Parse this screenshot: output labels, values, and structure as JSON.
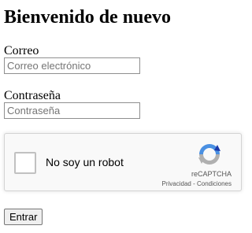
{
  "page": {
    "title": "Bienvenido de nuevo"
  },
  "form": {
    "email_label": "Correo",
    "email_value": "",
    "email_placeholder": "Correo electrónico",
    "password_label": "Contraseña",
    "password_value": "",
    "password_placeholder": "Contraseña",
    "submit_label": "Entrar"
  },
  "recaptcha": {
    "checkbox_checked": false,
    "label": "No soy un robot",
    "brand": "reCAPTCHA",
    "privacy_link": "Privacidad",
    "separator": " - ",
    "terms_link": "Condiciones",
    "logo_icon": "recaptcha-logo-icon",
    "colors": {
      "logo_blue": "#4a90e2",
      "logo_dark_blue": "#1c3aa9",
      "logo_gray": "#b0b0b0",
      "panel_background": "#f9f9f9"
    }
  }
}
